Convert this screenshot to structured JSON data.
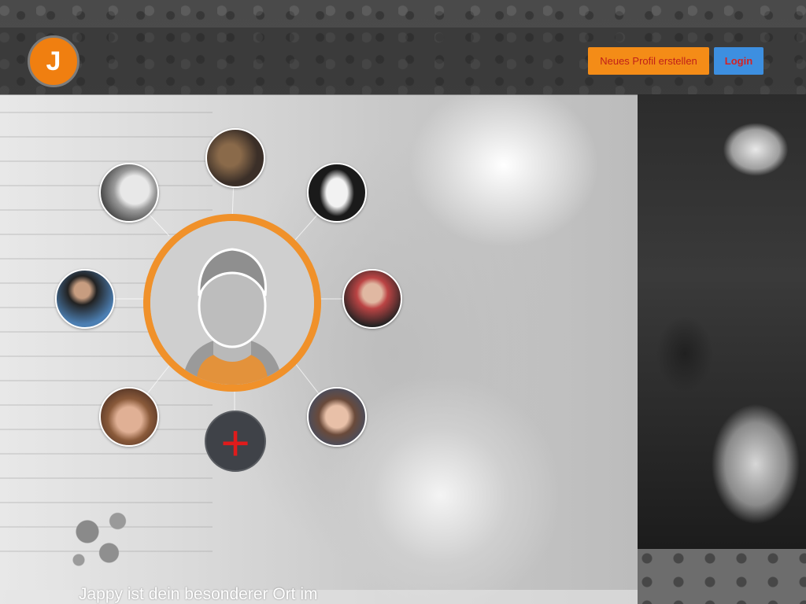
{
  "header": {
    "logo_letter": "J",
    "register_label": "Neues Profil erstellen",
    "login_label": "Login"
  },
  "network": {
    "friends": [
      {
        "name": "avatar-top",
        "colors": [
          "#8a6a4a",
          "#3b2f28"
        ]
      },
      {
        "name": "avatar-left-upper",
        "colors": [
          "#f0f0f0",
          "#444444"
        ]
      },
      {
        "name": "avatar-right-upper",
        "colors": [
          "#efefef",
          "#1a1a1a"
        ]
      },
      {
        "name": "avatar-left-middle",
        "colors": [
          "#4c7fb3",
          "#9a8a7a"
        ]
      },
      {
        "name": "avatar-right-middle",
        "colors": [
          "#b44",
          "#222"
        ]
      },
      {
        "name": "avatar-left-lower",
        "colors": [
          "#c59a7c",
          "#5a3a2a"
        ]
      },
      {
        "name": "avatar-right-lower",
        "colors": [
          "#6a4a3a",
          "#3f4f6a"
        ]
      }
    ],
    "add_symbol": "+",
    "accent_color": "#f0912a"
  },
  "tagline": "Jappy ist dein besonderer Ort im"
}
